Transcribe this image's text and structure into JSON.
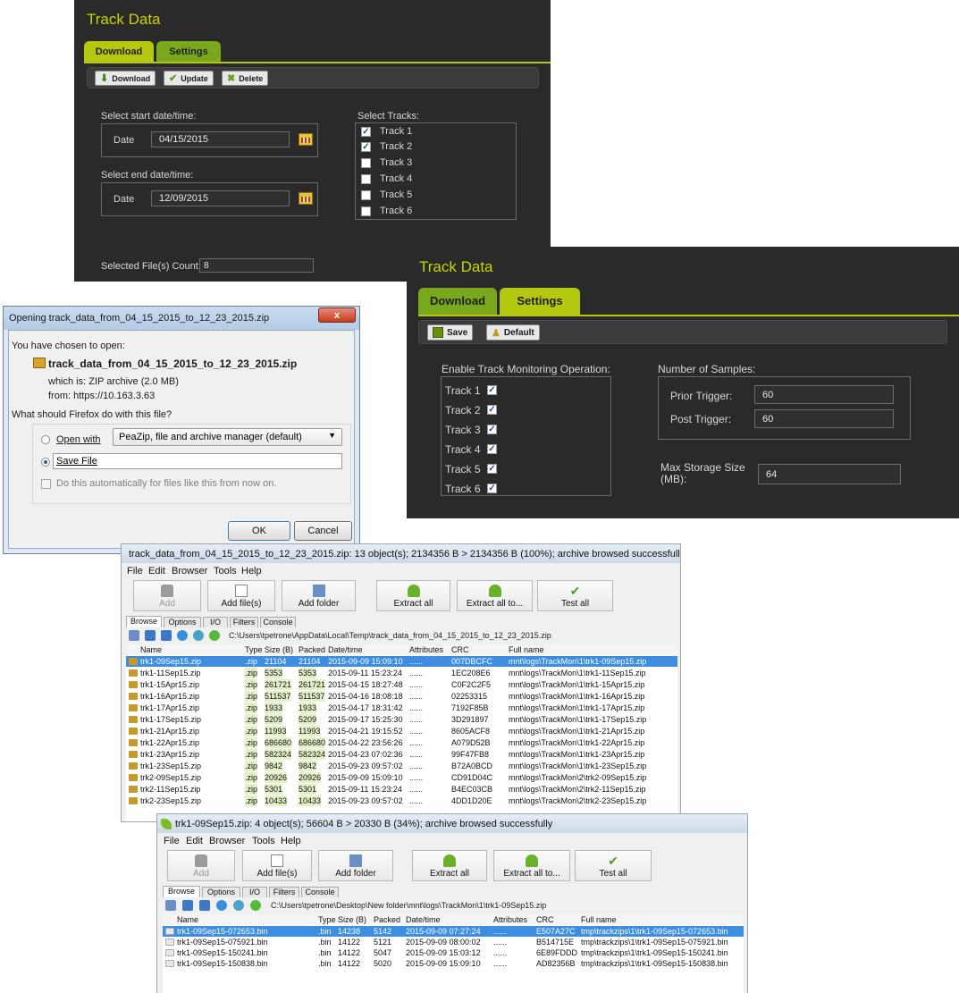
{
  "panel1": {
    "title": "Track Data",
    "tabs": {
      "download": "Download",
      "settings": "Settings"
    },
    "toolbar": {
      "download": "Download",
      "update": "Update",
      "delete": "Delete"
    },
    "start_label": "Select start date/time:",
    "end_label": "Select end date/time:",
    "date_label": "Date",
    "start_date": "04/15/2015",
    "end_date": "12/09/2015",
    "tracks_label": "Select Tracks:",
    "tracks": [
      {
        "label": "Track 1",
        "checked": true
      },
      {
        "label": "Track 2",
        "checked": true
      },
      {
        "label": "Track 3",
        "checked": false
      },
      {
        "label": "Track 4",
        "checked": false
      },
      {
        "label": "Track 5",
        "checked": false
      },
      {
        "label": "Track 6",
        "checked": false
      }
    ],
    "count_label": "Selected File(s) Count:",
    "count_value": "8"
  },
  "panel2": {
    "title": "Track Data",
    "tabs": {
      "download": "Download",
      "settings": "Settings"
    },
    "toolbar": {
      "save": "Save",
      "default": "Default"
    },
    "monitor_label": "Enable Track Monitoring Operation:",
    "tracks": [
      "Track 1",
      "Track 2",
      "Track 3",
      "Track 4",
      "Track 5",
      "Track 6"
    ],
    "samples_label": "Number of Samples:",
    "prior_label": "Prior Trigger:",
    "prior_value": "60",
    "post_label": "Post Trigger:",
    "post_value": "60",
    "storage_label": "Max Storage Size (MB):",
    "storage_value": "64"
  },
  "dialog": {
    "title": "Opening track_data_from_04_15_2015_to_12_23_2015.zip",
    "chosen": "You have chosen to open:",
    "filename": "track_data_from_04_15_2015_to_12_23_2015.zip",
    "which_is": "which is: ZIP archive (2.0 MB)",
    "from": "from: https://10.163.3.63",
    "question": "What should Firefox do with this file?",
    "open_with": "Open with",
    "app": "PeaZip, file and archive manager (default)",
    "save_file": "Save File",
    "auto": "Do this automatically for files like this from now on.",
    "ok": "OK",
    "cancel": "Cancel",
    "close": "x"
  },
  "peazip1": {
    "title": "track_data_from_04_15_2015_to_12_23_2015.zip: 13 object(s); 2134356 B > 2134356 B (100%); archive browsed successfully",
    "menu": [
      "File",
      "Edit",
      "Browser",
      "Tools",
      "Help"
    ],
    "toolbar": [
      "Add",
      "Add file(s)",
      "Add folder",
      "Extract all",
      "Extract all to...",
      "Test all"
    ],
    "tabs": [
      "Browse",
      "Options",
      "I/O",
      "Filters",
      "Console"
    ],
    "path": "C:\\Users\\tpetrone\\AppData\\Local\\Temp\\track_data_from_04_15_2015_to_12_23_2015.zip",
    "columns": [
      "Name",
      "Type",
      "Size (B)",
      "Packed",
      "Date/time",
      "Attributes",
      "CRC",
      "Full name"
    ],
    "rows": [
      [
        "trk1-09Sep15.zip",
        ".zip",
        "21104",
        "21104",
        "2015-09-09 15:09:10",
        "......",
        "007DBCFC",
        "mnt\\logs\\TrackMon\\1\\trk1-09Sep15.zip"
      ],
      [
        "trk1-11Sep15.zip",
        ".zip",
        "5353",
        "5353",
        "2015-09-11 15:23:24",
        "......",
        "1EC208E6",
        "mnt\\logs\\TrackMon\\1\\trk1-11Sep15.zip"
      ],
      [
        "trk1-15Apr15.zip",
        ".zip",
        "261721",
        "261721",
        "2015-04-15 18:27:48",
        "......",
        "C0F2C2F5",
        "mnt\\logs\\TrackMon\\1\\trk1-15Apr15.zip"
      ],
      [
        "trk1-16Apr15.zip",
        ".zip",
        "511537",
        "511537",
        "2015-04-16 18:08:18",
        "......",
        "02253315",
        "mnt\\logs\\TrackMon\\1\\trk1-16Apr15.zip"
      ],
      [
        "trk1-17Apr15.zip",
        ".zip",
        "1933",
        "1933",
        "2015-04-17 18:31:42",
        "......",
        "7192F85B",
        "mnt\\logs\\TrackMon\\1\\trk1-17Apr15.zip"
      ],
      [
        "trk1-17Sep15.zip",
        ".zip",
        "5209",
        "5209",
        "2015-09-17 15:25:30",
        "......",
        "3D291897",
        "mnt\\logs\\TrackMon\\1\\trk1-17Sep15.zip"
      ],
      [
        "trk1-21Apr15.zip",
        ".zip",
        "11993",
        "11993",
        "2015-04-21 19:15:52",
        "......",
        "8605ACF8",
        "mnt\\logs\\TrackMon\\1\\trk1-21Apr15.zip"
      ],
      [
        "trk1-22Apr15.zip",
        ".zip",
        "686680",
        "686680",
        "2015-04-22 23:56:26",
        "......",
        "A079D52B",
        "mnt\\logs\\TrackMon\\1\\trk1-22Apr15.zip"
      ],
      [
        "trk1-23Apr15.zip",
        ".zip",
        "582324",
        "582324",
        "2015-04-23 07:02:36",
        "......",
        "99F47FB8",
        "mnt\\logs\\TrackMon\\1\\trk1-23Apr15.zip"
      ],
      [
        "trk1-23Sep15.zip",
        ".zip",
        "9842",
        "9842",
        "2015-09-23 09:57:02",
        "......",
        "B72A0BCD",
        "mnt\\logs\\TrackMon\\1\\trk1-23Sep15.zip"
      ],
      [
        "trk2-09Sep15.zip",
        ".zip",
        "20926",
        "20926",
        "2015-09-09 15:09:10",
        "......",
        "CD91D04C",
        "mnt\\logs\\TrackMon\\2\\trk2-09Sep15.zip"
      ],
      [
        "trk2-11Sep15.zip",
        ".zip",
        "5301",
        "5301",
        "2015-09-11 15:23:24",
        "......",
        "B4EC03CB",
        "mnt\\logs\\TrackMon\\2\\trk2-11Sep15.zip"
      ],
      [
        "trk2-23Sep15.zip",
        ".zip",
        "10433",
        "10433",
        "2015-09-23 09:57:02",
        "......",
        "4DD1D20E",
        "mnt\\logs\\TrackMon\\2\\trk2-23Sep15.zip"
      ]
    ]
  },
  "peazip2": {
    "title": "trk1-09Sep15.zip: 4 object(s); 56604 B > 20330 B (34%); archive browsed successfully",
    "menu": [
      "File",
      "Edit",
      "Browser",
      "Tools",
      "Help"
    ],
    "toolbar": [
      "Add",
      "Add file(s)",
      "Add folder",
      "Extract all",
      "Extract all to...",
      "Test all"
    ],
    "tabs": [
      "Browse",
      "Options",
      "I/O",
      "Filters",
      "Console"
    ],
    "path": "C:\\Users\\tpetrone\\Desktop\\New folder\\mnt\\logs\\TrackMon\\1\\trk1-09Sep15.zip",
    "columns": [
      "Name",
      "Type",
      "Size (B)",
      "Packed",
      "Date/time",
      "Attributes",
      "CRC",
      "Full name"
    ],
    "rows": [
      [
        "trk1-09Sep15-072653.bin",
        ".bin",
        "14238",
        "5142",
        "2015-09-09 07:27:24",
        "......",
        "E507A27C",
        "tmp\\trackzips\\1\\trk1-09Sep15-072653.bin"
      ],
      [
        "trk1-09Sep15-075921.bin",
        ".bin",
        "14122",
        "5121",
        "2015-09-09 08:00:02",
        "......",
        "B514715E",
        "tmp\\trackzips\\1\\trk1-09Sep15-075921.bin"
      ],
      [
        "trk1-09Sep15-150241.bin",
        ".bin",
        "14122",
        "5047",
        "2015-09-09 15:03:12",
        "......",
        "6E89FDDD",
        "tmp\\trackzips\\1\\trk1-09Sep15-150241.bin"
      ],
      [
        "trk1-09Sep15-150838.bin",
        ".bin",
        "14122",
        "5020",
        "2015-09-09 15:09:10",
        "......",
        "AD82356B",
        "tmp\\trackzips\\1\\trk1-09Sep15-150838.bin"
      ]
    ]
  }
}
